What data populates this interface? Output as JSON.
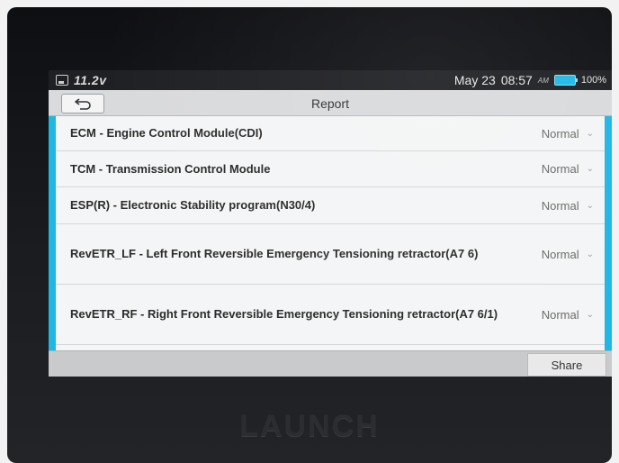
{
  "status_bar": {
    "voltage": "11.2v",
    "date": "May 23",
    "time": "08:57",
    "ampm": "AM",
    "battery": "100%",
    "battery_color": "#1fbbe6"
  },
  "title_bar": {
    "title": "Report",
    "back_icon": "return-arrow-icon"
  },
  "report_rows": [
    {
      "label": "ECM - Engine Control Module(CDI)",
      "status": "Normal"
    },
    {
      "label": "TCM - Transmission Control Module",
      "status": "Normal"
    },
    {
      "label": "ESP(R) - Electronic Stability program(N30/4)",
      "status": "Normal"
    },
    {
      "label": "RevETR_LF - Left Front Reversible Emergency Tensioning retractor(A7 6)",
      "status": "Normal"
    },
    {
      "label": "RevETR_RF - Right Front Reversible Emergency Tensioning retractor(A7 6/1)",
      "status": "Normal"
    }
  ],
  "bottom_bar": {
    "share_label": "Share"
  },
  "device": {
    "brand": "LAUNCH"
  },
  "colors": {
    "accent": "#1fb7e4"
  }
}
